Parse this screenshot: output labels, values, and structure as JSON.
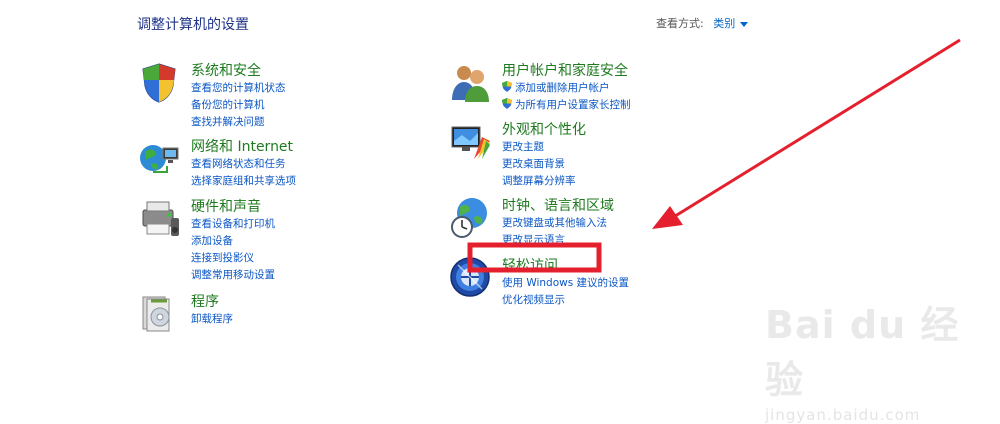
{
  "header": {
    "title": "调整计算机的设置",
    "view_by_label": "查看方式:",
    "view_by_value": "类别"
  },
  "categories": [
    {
      "title": "系统和安全",
      "icon": "system-security-icon",
      "links": [
        "查看您的计算机状态",
        "备份您的计算机",
        "查找并解决问题"
      ]
    },
    {
      "title": "网络和 Internet",
      "icon": "network-icon",
      "links": [
        "查看网络状态和任务",
        "选择家庭组和共享选项"
      ]
    },
    {
      "title": "硬件和声音",
      "icon": "hardware-sound-icon",
      "links": [
        "查看设备和打印机",
        "添加设备",
        "连接到投影仪",
        "调整常用移动设置"
      ]
    },
    {
      "title": "程序",
      "icon": "programs-icon",
      "links": [
        "卸载程序"
      ]
    },
    {
      "title": "用户帐户和家庭安全",
      "icon": "user-accounts-icon",
      "links": [
        "添加或删除用户帐户",
        "为所有用户设置家长控制"
      ]
    },
    {
      "title": "外观和个性化",
      "icon": "appearance-icon",
      "links": [
        "更改主题",
        "更改桌面背景",
        "调整屏幕分辨率"
      ]
    },
    {
      "title": "时钟、语言和区域",
      "icon": "clock-language-region-icon",
      "links": [
        "更改键盘或其他输入法",
        "更改显示语言"
      ]
    },
    {
      "title": "轻松访问",
      "icon": "ease-of-access-icon",
      "links": [
        "使用 Windows 建议的设置",
        "优化视频显示"
      ]
    }
  ],
  "annotation": {
    "highlight_color": "#e5202e",
    "arrow_color": "#e5202e"
  },
  "watermark": {
    "logo": "Bai du 经验",
    "sub": "jingyan.baidu.com"
  }
}
